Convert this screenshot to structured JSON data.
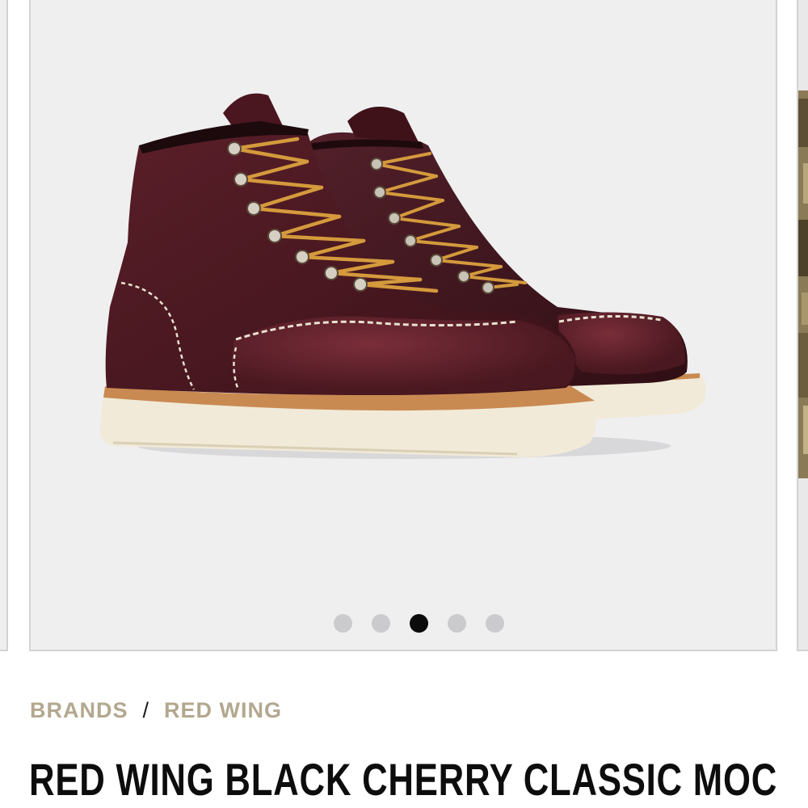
{
  "carousel": {
    "image": {
      "subject": "pair of dark cherry leather moc toe lace-up boots with cream wedge soles",
      "colors": {
        "leather": "#4a1820",
        "sole": "#f1ead8",
        "laces": "#d49a3c",
        "background": "#efeff0"
      }
    },
    "dots": [
      {
        "label": "slide 1",
        "active": false
      },
      {
        "label": "slide 2",
        "active": false
      },
      {
        "label": "slide 3",
        "active": true
      },
      {
        "label": "slide 4",
        "active": false
      },
      {
        "label": "slide 5",
        "active": false
      }
    ],
    "active_index": 2
  },
  "breadcrumb": {
    "items": [
      {
        "label": "BRANDS"
      },
      {
        "label": "RED WING"
      }
    ],
    "separator": "/",
    "color": "#b3a88f"
  },
  "product": {
    "title": "RED WING BLACK CHERRY CLASSIC MOC"
  }
}
